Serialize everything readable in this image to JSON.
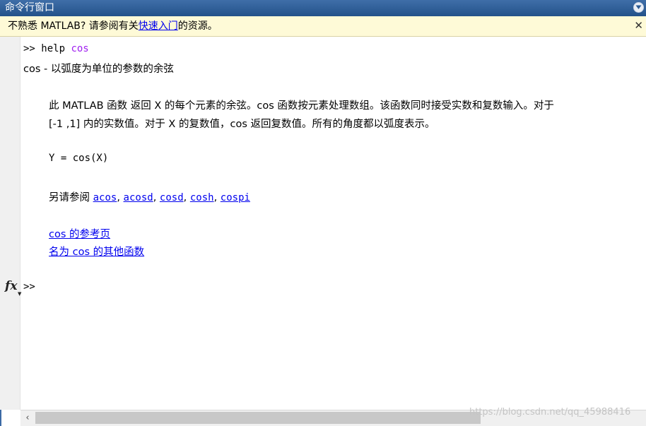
{
  "window": {
    "title": "命令行窗口"
  },
  "notice": {
    "text_before": "不熟悉 MATLAB? 请参阅有关",
    "link": "快速入门",
    "text_after": "的资源。",
    "close": "✕"
  },
  "console": {
    "prompt": ">>",
    "command_keyword": "help",
    "command_arg": "cos",
    "heading": "cos - 以弧度为单位的参数的余弦",
    "description_line1": "此 MATLAB 函数 返回 X 的每个元素的余弦。cos 函数按元素处理数组。该函数同时接受实数和复数输入。对于",
    "description_line2": "[-1 ,1] 内的实数值。对于 X 的复数值，cos 返回复数值。所有的角度都以弧度表示。",
    "syntax": "Y = cos(X)",
    "see_also_label": "另请参阅 ",
    "see_also": [
      "acos",
      "acosd",
      "cosd",
      "cosh",
      "cospi"
    ],
    "see_also_sep": ", ",
    "reference_link": "cos 的参考页",
    "others_link": "名为 cos 的其他函数",
    "current_prompt": ">>"
  },
  "gutter": {
    "fx_label": "fx",
    "fx_caret": "▼"
  },
  "scrollbar": {
    "left_arrow": "‹"
  },
  "watermark": "https://blog.csdn.net/qq_45988416",
  "colors": {
    "title_bg": "#2b5a93",
    "notice_bg": "#fefad7",
    "link": "#0000ee",
    "keyword_arg": "#a020f0"
  }
}
